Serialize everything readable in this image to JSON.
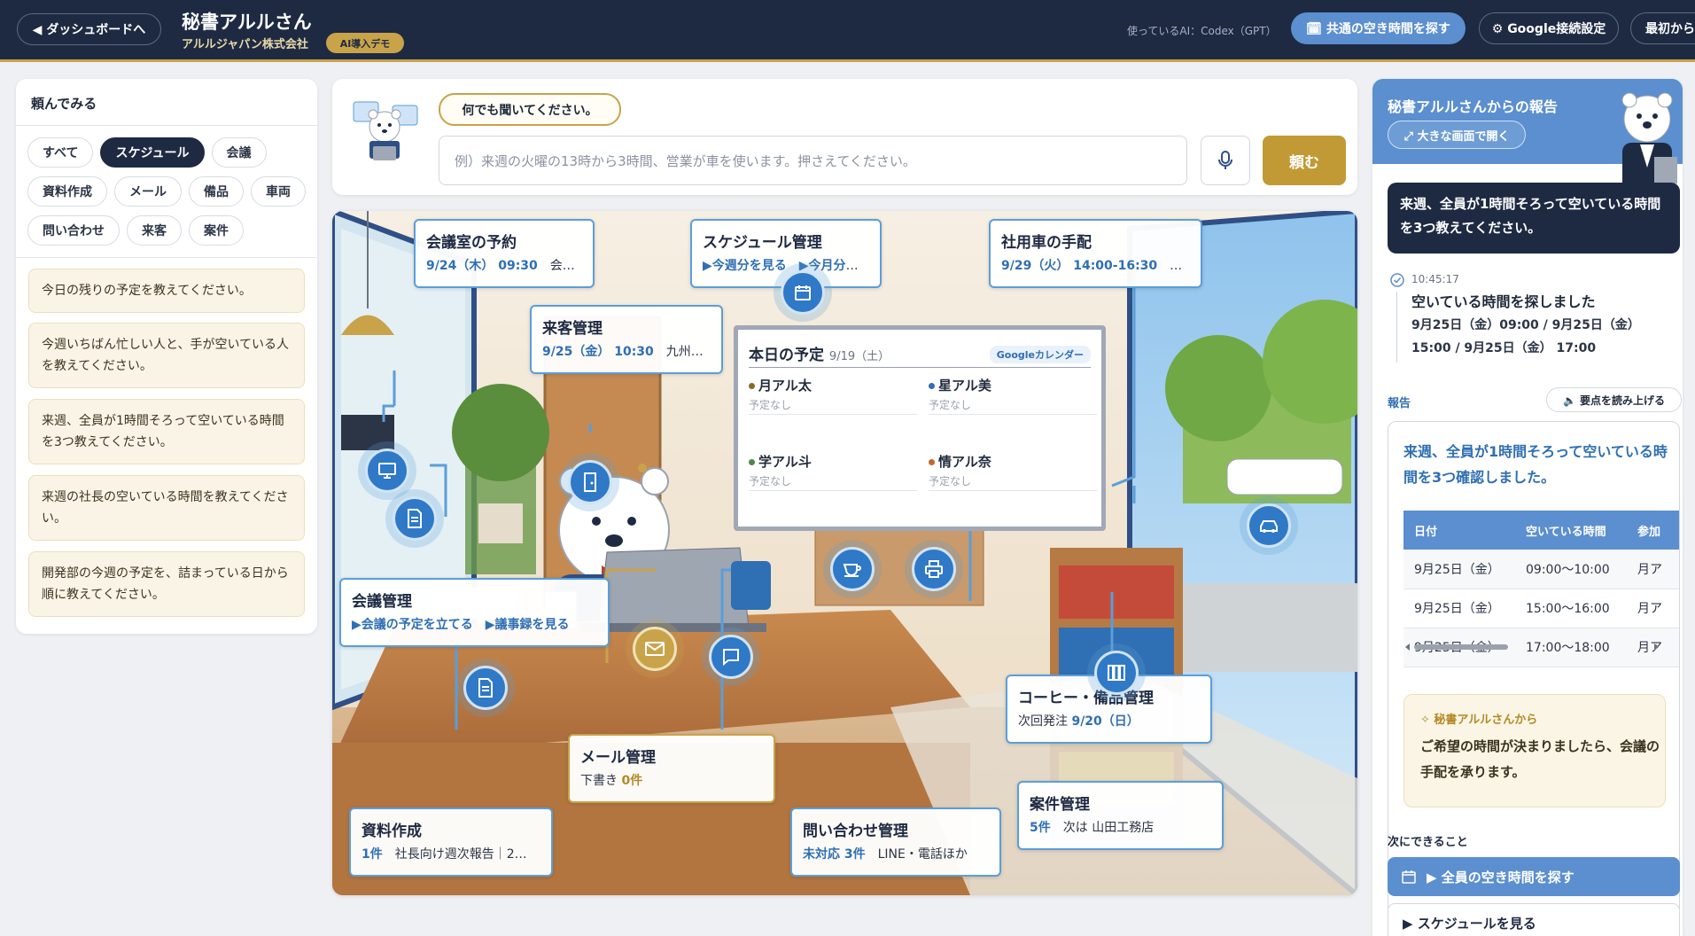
{
  "header": {
    "back_label": "◀ ダッシュボードへ",
    "title": "秘書アルルさん",
    "company": "アルルジャパン株式会社",
    "demo_badge": "AI導入デモ",
    "ai_label": "使っているAI：Codex（GPT）",
    "find_common_label": "🗓 共通の空き時間を探す",
    "google_label": "⚙ Google接続設定",
    "restart_label": "最初から"
  },
  "left": {
    "title": "頼んでみる",
    "chips": [
      {
        "label": "すべて",
        "active": false
      },
      {
        "label": "スケジュール",
        "active": true
      },
      {
        "label": "会議",
        "active": false
      },
      {
        "label": "資料作成",
        "active": false
      },
      {
        "label": "メール",
        "active": false
      },
      {
        "label": "備品",
        "active": false
      },
      {
        "label": "車両",
        "active": false
      },
      {
        "label": "問い合わせ",
        "active": false
      },
      {
        "label": "来客",
        "active": false
      },
      {
        "label": "案件",
        "active": false
      }
    ],
    "suggestions": [
      "今日の残りの予定を教えてください。",
      "今週いちばん忙しい人と、手が空いている人を教えてください。",
      "来週、全員が1時間そろって空いている時間を3つ教えてください。",
      "来週の社長の空いている時間を教えてください。",
      "開発部の今週の予定を、詰まっている日から順に教えてください。"
    ]
  },
  "ask": {
    "bubble": "何でも聞いてください。",
    "placeholder": "例）来週の火曜の13時から3時間、営業が車を使います。押さえてください。",
    "submit_label": "頼む"
  },
  "scene": {
    "meeting_room": {
      "title": "会議室の予約",
      "date": "9/24（木） 09:30",
      "detail": "会議室A"
    },
    "schedule": {
      "title": "スケジュール管理",
      "link1": "▶今週分を見る",
      "link2": "▶今月分を見る"
    },
    "car": {
      "title": "社用車の手配",
      "date": "9/29（火） 14:00-16:30",
      "detail": "…"
    },
    "visitor": {
      "title": "来客管理",
      "date": "9/25（金） 10:30",
      "detail": "九州…"
    },
    "meeting": {
      "title": "会議管理",
      "link1": "▶会議の予定を立てる",
      "link2": "▶議事録を見る"
    },
    "coffee": {
      "title": "コーヒー・備品管理",
      "prefix": "次回発注",
      "date": "9/20（日）"
    },
    "mail": {
      "title": "メール管理",
      "prefix": "下書き",
      "count": "0件"
    },
    "project": {
      "title": "案件管理",
      "count": "5件",
      "detail": "次は 山田工務店"
    },
    "docs": {
      "title": "資料作成",
      "count": "1件",
      "detail": "社長向け週次報告｜2…"
    },
    "inquiry": {
      "title": "問い合わせ管理",
      "count": "未対応 3件",
      "detail": "LINE・電話ほか"
    },
    "board": {
      "title": "本日の予定",
      "date": "9/19（土）",
      "badge": "Googleカレンダー",
      "people": [
        {
          "name": "月アル太",
          "note": "予定なし",
          "color": "#8a6a2a"
        },
        {
          "name": "星アル美",
          "note": "予定なし",
          "color": "#2f6fb3"
        },
        {
          "name": "学アル斗",
          "note": "予定なし",
          "color": "#4a8a4a"
        },
        {
          "name": "情アル奈",
          "note": "予定なし",
          "color": "#c06a2a"
        }
      ]
    }
  },
  "right": {
    "title": "秘書アルルさんからの報告",
    "open_large": "⤢ 大きな画面で開く",
    "question": "来週、全員が1時間そろって空いている時間を3つ教えてください。",
    "timeline": {
      "time": "10:45:17",
      "title": "空いている時間を探しました",
      "body": "9月25日（金）09:00 / 9月25日（金） 15:00 / 9月25日（金） 17:00"
    },
    "report_label": "報告",
    "read_aloud": "🔈 要点を読み上げる",
    "lead": "来週、全員が1時間そろって空いている時間を3つ確認しました。",
    "table": {
      "headers": [
        "日付",
        "空いている時間",
        "参加"
      ],
      "rows": [
        [
          "9月25日（金）",
          "09:00〜10:00",
          "月ア"
        ],
        [
          "9月25日（金）",
          "15:00〜16:00",
          "月ア"
        ],
        [
          "9月25日（金）",
          "17:00〜18:00",
          "月ア"
        ]
      ]
    },
    "note_title": "✧ 秘書アルルさんから",
    "note_body": "ご希望の時間が決まりましたら、会議の手配を承ります。",
    "next_label": "次にできること",
    "next1": "▶ 全員の空き時間を探す",
    "next2": "▶ スケジュールを見る"
  }
}
